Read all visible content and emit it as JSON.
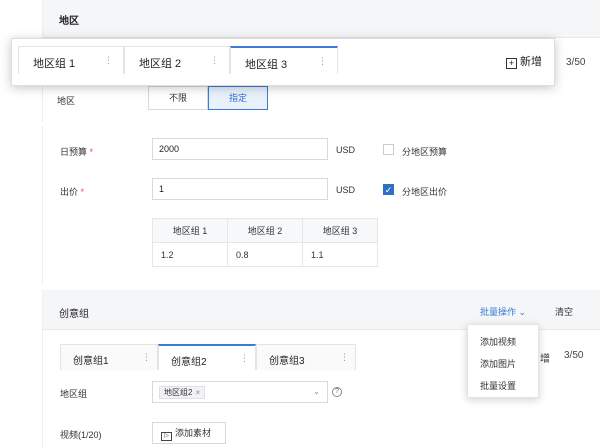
{
  "region_panel": {
    "title": "地区",
    "tabs": [
      {
        "label": "地区组 1"
      },
      {
        "label": "地区组 2"
      },
      {
        "label": "地区组 3"
      }
    ],
    "add_label": "新增",
    "count": "3/50",
    "region_label": "地区",
    "options": [
      "不限",
      "指定"
    ],
    "selected_option": "指定"
  },
  "budget_panel": {
    "daily_budget_label": "日预算",
    "daily_budget_value": "2000",
    "currency": "USD",
    "region_budget_label": "分地区预算",
    "region_budget_checked": false,
    "bid_label": "出价",
    "bid_value": "1",
    "region_bid_label": "分地区出价",
    "region_bid_checked": true,
    "bid_table": {
      "headers": [
        "地区组 1",
        "地区组 2",
        "地区组 3"
      ],
      "values": [
        "1.2",
        "0.8",
        "1.1"
      ]
    }
  },
  "creative_panel": {
    "title": "创意组",
    "batch_label": "批量操作",
    "clear_label": "清空",
    "menu_items": [
      "添加视频",
      "添加图片",
      "批量设置"
    ],
    "tabs": [
      {
        "label": "创意组1"
      },
      {
        "label": "创意组2"
      },
      {
        "label": "创意组3"
      }
    ],
    "peek_text": "增",
    "count": "3/50",
    "region_group_label": "地区组",
    "region_tag": "地区组2",
    "video_label": "视频(1/20)",
    "add_material_label": "添加素材"
  },
  "colors": {
    "accent": "#3b7cd6",
    "required": "#e34d4d"
  }
}
